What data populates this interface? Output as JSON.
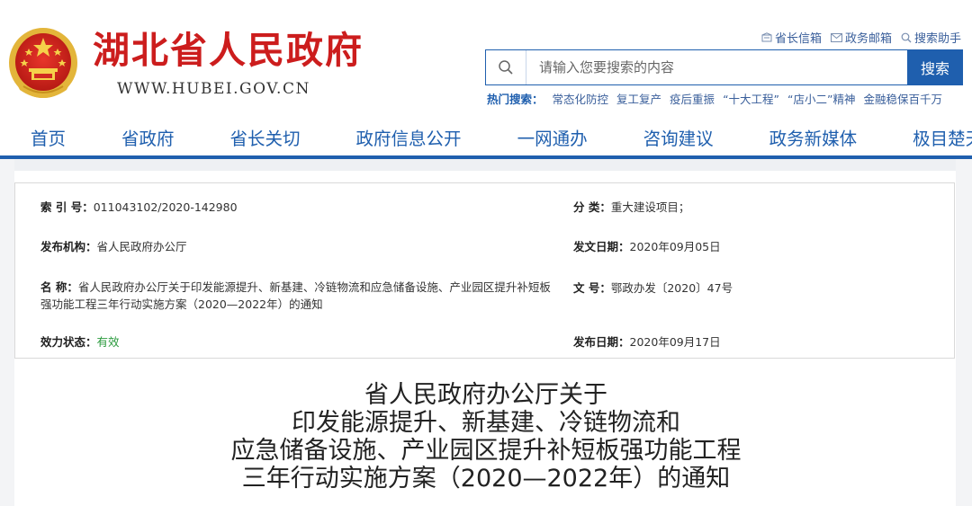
{
  "site": {
    "title": "湖北省人民政府",
    "url": "WWW.HUBEI.GOV.CN"
  },
  "top_links": [
    {
      "label": "省长信箱",
      "icon": "mailbox-icon"
    },
    {
      "label": "政务邮箱",
      "icon": "envelope-icon"
    },
    {
      "label": "搜索助手",
      "icon": "search-icon"
    }
  ],
  "search": {
    "placeholder": "请输入您要搜索的内容",
    "button_label": "搜索"
  },
  "hot_search": {
    "label": "热门搜索：",
    "items": [
      "常态化防控",
      "复工复产",
      "疫后重振",
      "“十大工程”",
      "“店小二”精神",
      "金融稳保百千万"
    ]
  },
  "nav": [
    "首页",
    "省政府",
    "省长关切",
    "政府信息公开",
    "一网通办",
    "咨询建议",
    "政务新媒体",
    "极目楚天"
  ],
  "info": {
    "index_label": "索 引 号：",
    "index_value": "011043102/2020-142980",
    "category_label": "分 类：",
    "category_value": "重大建设项目；",
    "publisher_label": "发布机构：",
    "publisher_value": "省人民政府办公厅",
    "doc_date_label": "发文日期：",
    "doc_date_value": "2020年09月05日",
    "name_label": "名 称：",
    "name_value": "省人民政府办公厅关于印发能源提升、新基建、冷链物流和应急储备设施、产业园区提升补短板强功能工程三年行动实施方案（2020—2022年）的通知",
    "doc_no_label": "文 号：",
    "doc_no_value": "鄂政办发〔2020〕47号",
    "status_label": "效力状态：",
    "status_value": "有效",
    "pub_date_label": "发布日期：",
    "pub_date_value": "2020年09月17日"
  },
  "doc_title": [
    "省人民政府办公厅关于",
    "印发能源提升、新基建、冷链物流和",
    "应急储备设施、产业园区提升补短板强功能工程",
    "三年行动实施方案（2020—2022年）的通知"
  ],
  "colors": {
    "brand_red": "#cc1d1d",
    "brand_blue": "#1f5fae",
    "valid_green": "#2a9a3d"
  }
}
